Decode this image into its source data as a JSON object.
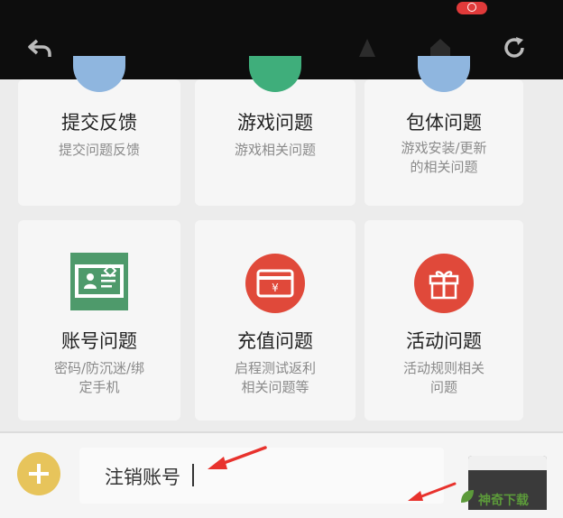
{
  "toolbar": {
    "back_icon": "back-arrow-icon",
    "refresh_icon": "refresh-icon"
  },
  "cards": [
    {
      "title": "提交反馈",
      "sub": [
        "提交问题反馈"
      ],
      "accent": "#8fb6df"
    },
    {
      "title": "游戏问题",
      "sub": [
        "游戏相关问题"
      ],
      "accent": "#3fae7b"
    },
    {
      "title": "包体问题",
      "sub": [
        "游戏安装/更新",
        "的相关问题"
      ],
      "accent": "#8fb6df"
    },
    {
      "title": "账号问题",
      "sub": [
        "密码/防沉迷/绑",
        "定手机"
      ],
      "icon": "id-card-icon",
      "accent": "#4e9a6b"
    },
    {
      "title": "充值问题",
      "sub": [
        "启程测试返利",
        "相关问题等"
      ],
      "icon": "recharge-card-icon",
      "accent": "#e0493a"
    },
    {
      "title": "活动问题",
      "sub": [
        "活动规则相关",
        "问题"
      ],
      "icon": "gift-icon",
      "accent": "#e0493a"
    }
  ],
  "input": {
    "value": "注销账号"
  },
  "watermark": "神奇下载",
  "colors": {
    "plus_button": "#e7c45b",
    "annotation_arrow": "#e8322d"
  }
}
